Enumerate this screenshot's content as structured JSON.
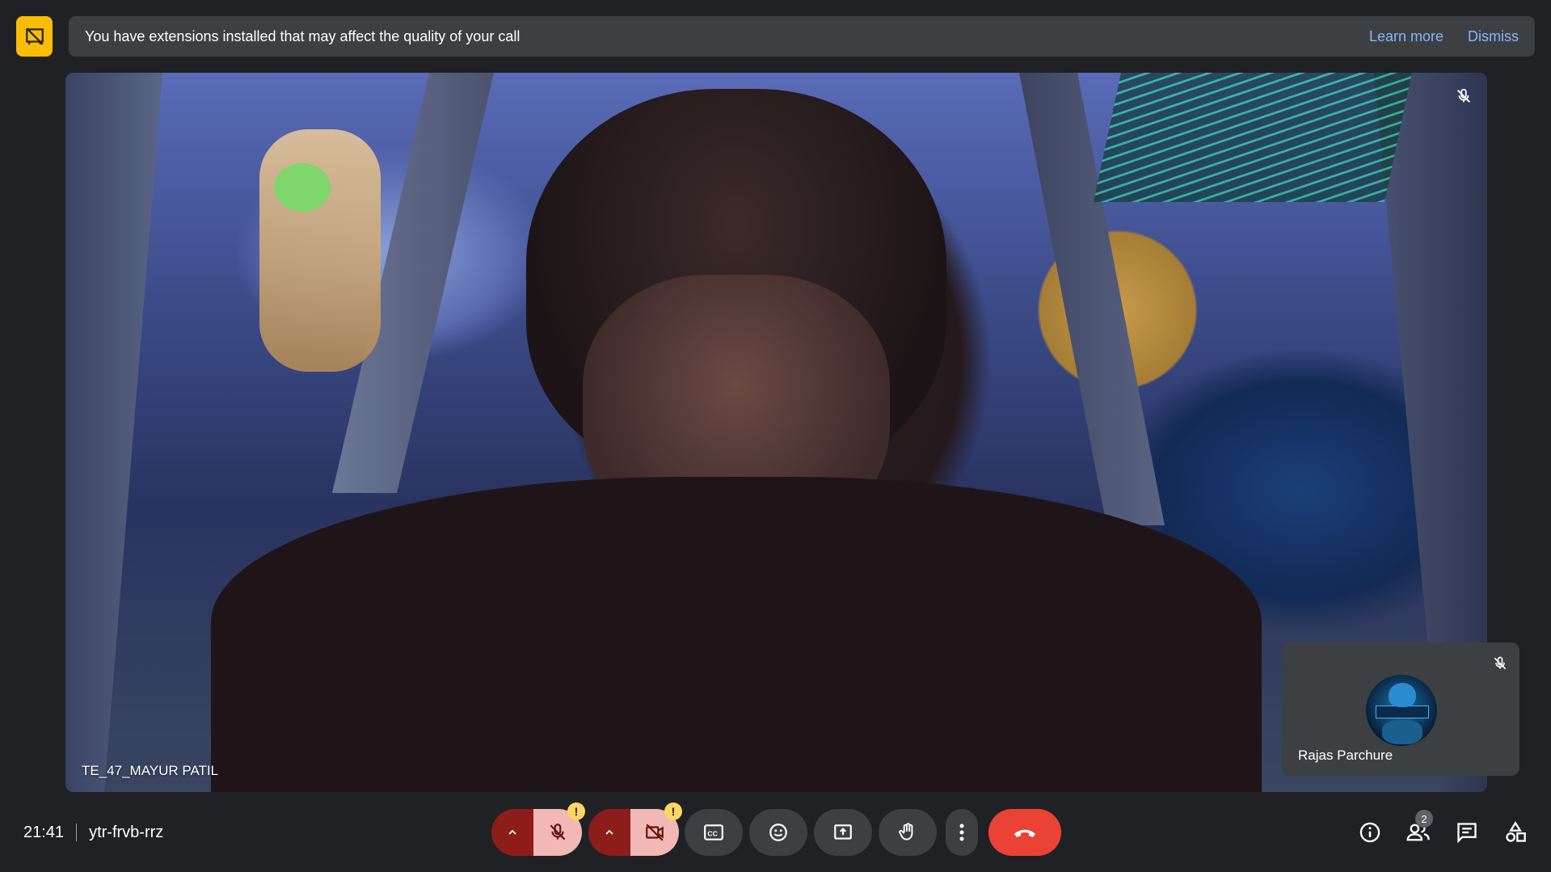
{
  "banner": {
    "message": "You have extensions installed that may affect the quality of your call",
    "learn_more": "Learn more",
    "dismiss": "Dismiss"
  },
  "main_participant": {
    "name": "TE_47_MAYUR PATIL",
    "muted": true
  },
  "self_participant": {
    "name": "Rajas Parchure",
    "muted": true
  },
  "meeting": {
    "time": "21:41",
    "code": "ytr-frvb-rrz"
  },
  "controls": {
    "mic_warning": "!",
    "camera_warning": "!"
  },
  "people": {
    "count": "2"
  },
  "colors": {
    "background": "#202124",
    "banner": "#3c4043",
    "warning_yellow": "#fbbc04",
    "end_call_red": "#ea4335",
    "off_state_pink": "#f2b8b5",
    "off_state_dark": "#8c1d18",
    "link_blue": "#8ab4f8"
  },
  "icons": [
    "extension-warning-icon",
    "mic-off-icon",
    "chevron-up-icon",
    "camera-off-icon",
    "captions-icon",
    "emoji-icon",
    "present-screen-icon",
    "raise-hand-icon",
    "more-vert-icon",
    "end-call-icon",
    "info-icon",
    "people-icon",
    "chat-icon",
    "activities-icon"
  ]
}
